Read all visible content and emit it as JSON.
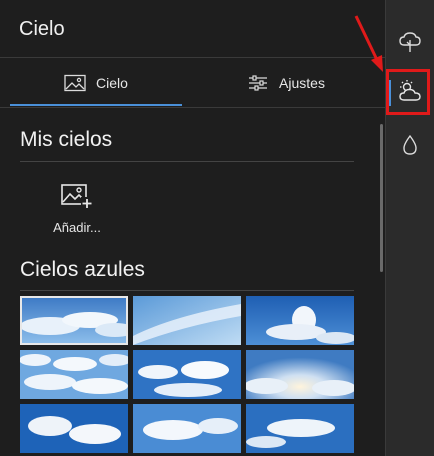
{
  "header": {
    "title": "Cielo"
  },
  "tabs": [
    {
      "label": "Cielo",
      "icon": "image-icon",
      "active": true
    },
    {
      "label": "Ajustes",
      "icon": "sliders-icon",
      "active": false
    }
  ],
  "sections": {
    "mis_cielos": {
      "title": "Mis cielos",
      "add_label": "Añadir..."
    },
    "cielos_azules": {
      "title": "Cielos azules"
    }
  },
  "thumbnails": [
    {
      "name": "sky-thumb-1",
      "selected": true
    },
    {
      "name": "sky-thumb-2",
      "selected": false
    },
    {
      "name": "sky-thumb-3",
      "selected": false
    },
    {
      "name": "sky-thumb-4",
      "selected": false
    },
    {
      "name": "sky-thumb-5",
      "selected": false
    },
    {
      "name": "sky-thumb-6",
      "selected": false
    },
    {
      "name": "sky-thumb-7",
      "selected": false
    },
    {
      "name": "sky-thumb-8",
      "selected": false
    },
    {
      "name": "sky-thumb-9",
      "selected": false
    }
  ],
  "rightbar": [
    {
      "icon": "tree-cloud-icon",
      "active": false
    },
    {
      "icon": "sun-cloud-icon",
      "active": true,
      "highlighted": true
    },
    {
      "icon": "water-drop-icon",
      "active": false
    }
  ],
  "colors": {
    "accent": "#4a90d9",
    "highlight": "#e01a1a",
    "background": "#1e1e1e"
  }
}
